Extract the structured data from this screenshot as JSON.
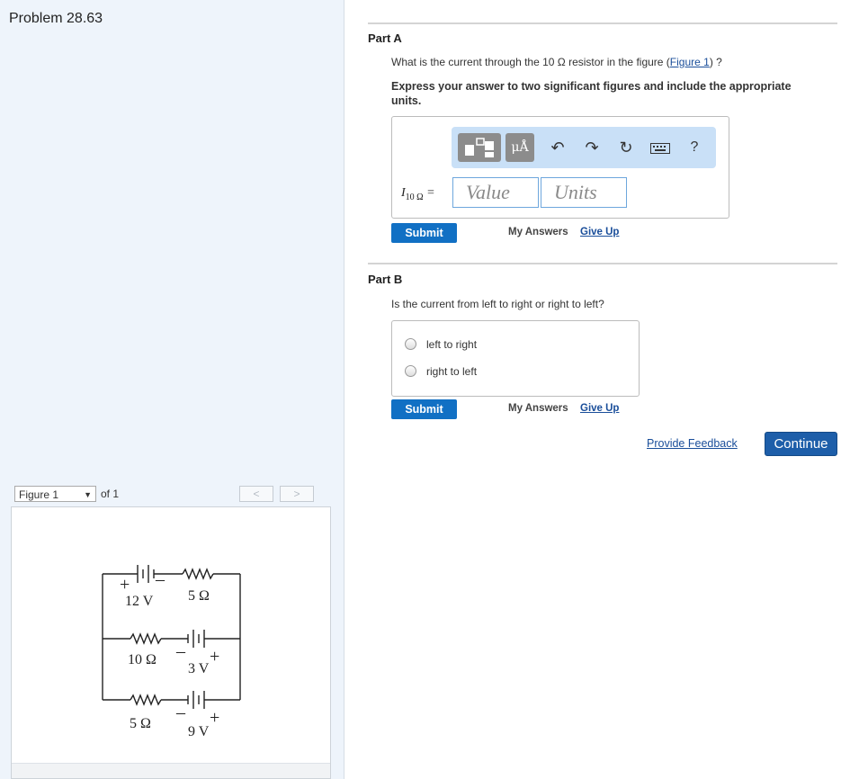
{
  "problem_title": "Problem 28.63",
  "figure_nav": {
    "selected": "Figure 1",
    "of_label": "of 1",
    "prev": "<",
    "next": ">"
  },
  "figure": {
    "labels": {
      "v12": "12 V",
      "r5a": "5 Ω",
      "r10": "10 Ω",
      "v3": "3 V",
      "r5b": "5 Ω",
      "v9": "9 V"
    }
  },
  "part_a": {
    "title": "Part A",
    "question_pre": "What is the current through the 10 Ω resistor in the figure (",
    "figure_link": "Figure 1",
    "question_post": ") ?",
    "instructions": "Express your answer to two significant figures and include the appropriate units.",
    "toolbar": {
      "units_label": "μÅ",
      "help_label": "?"
    },
    "symbol": "I",
    "symbol_sub": "10 Ω",
    "symbol_eq": " =",
    "value_placeholder": "Value",
    "units_placeholder": "Units",
    "submit": "Submit",
    "my_answers": "My Answers",
    "give_up": "Give Up"
  },
  "part_b": {
    "title": "Part B",
    "question": "Is the current from left to right or right to left?",
    "choices": [
      "left to right",
      "right to left"
    ],
    "submit": "Submit",
    "my_answers": "My Answers",
    "give_up": "Give Up"
  },
  "footer": {
    "feedback": "Provide Feedback",
    "continue": "Continue"
  }
}
